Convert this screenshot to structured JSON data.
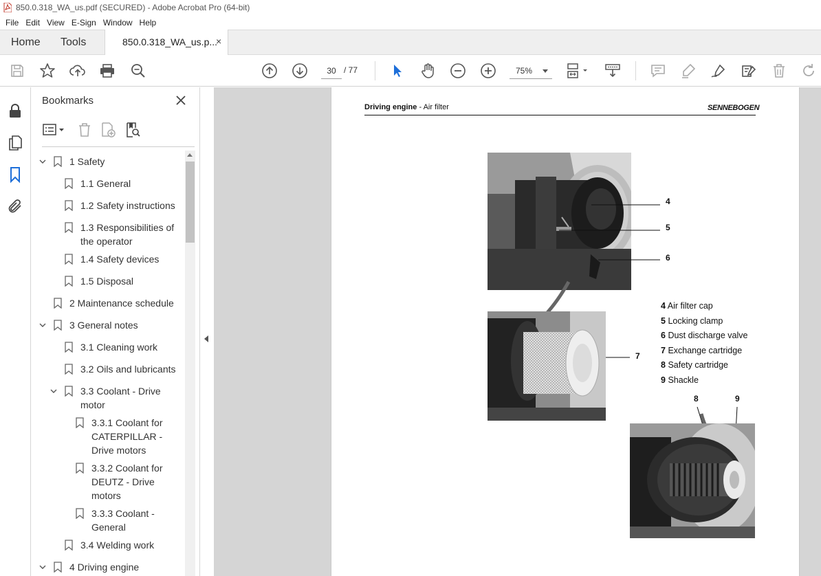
{
  "window": {
    "title": "850.0.318_WA_us.pdf (SECURED) - Adobe Acrobat Pro (64-bit)"
  },
  "menu": [
    "File",
    "Edit",
    "View",
    "E-Sign",
    "Window",
    "Help"
  ],
  "tabs": {
    "home": "Home",
    "tools": "Tools",
    "document": "850.0.318_WA_us.p...",
    "close": "×"
  },
  "toolbar": {
    "current_page": "30",
    "total_pages": "/ 77",
    "zoom": "75%",
    "icons": [
      "save-icon",
      "bookmark-star-icon",
      "upload-icon",
      "print-icon",
      "find-icon",
      "page-up-icon",
      "page-down-icon",
      "select-cursor-icon",
      "hand-icon",
      "zoom-out-icon",
      "zoom-in-icon",
      "fit-page-icon",
      "scroll-mode-icon",
      "comment-icon",
      "highlight-icon",
      "draw-icon",
      "fill-sign-icon",
      "delete-icon",
      "rotate-icon"
    ]
  },
  "panel": {
    "title": "Bookmarks",
    "items": [
      {
        "label": "1 Safety",
        "level": 0,
        "expanded": true,
        "has_children": true
      },
      {
        "label": "1.1 General",
        "level": 1
      },
      {
        "label": "1.2 Safety instructions",
        "level": 1
      },
      {
        "label": "1.3 Responsibilities of",
        "label2": "the operator",
        "level": 1
      },
      {
        "label": "1.4 Safety devices",
        "level": 1
      },
      {
        "label": "1.5 Disposal",
        "level": 1
      },
      {
        "label": "2 Maintenance schedule",
        "level": 0
      },
      {
        "label": "3 General notes",
        "level": 0,
        "expanded": true,
        "has_children": true
      },
      {
        "label": "3.1 Cleaning work",
        "level": 1
      },
      {
        "label": "3.2 Oils and lubricants",
        "level": 1
      },
      {
        "label": "3.3 Coolant - Drive",
        "label2": "motor",
        "level": 1,
        "expanded": true,
        "has_children": true
      },
      {
        "label": "3.3.1 Coolant for",
        "label2": "CATERPILLAR -",
        "label3": "Drive motors",
        "level": 2
      },
      {
        "label": "3.3.2 Coolant for",
        "label2": "DEUTZ - Drive",
        "label3": "motors",
        "level": 2
      },
      {
        "label": "3.3.3 Coolant -",
        "label2": "General",
        "level": 2
      },
      {
        "label": "3.4 Welding work",
        "level": 1
      },
      {
        "label": "4 Driving engine",
        "level": 0,
        "expanded": true,
        "has_children": true
      }
    ]
  },
  "page": {
    "header_bold": "Driving engine",
    "header_rest": " - Air filter",
    "brand": "SENNEBOGEN",
    "callouts": [
      "4",
      "5",
      "6",
      "7",
      "8",
      "9"
    ],
    "legend": [
      {
        "num": "4",
        "text": "Air filter cap"
      },
      {
        "num": "5",
        "text": "Locking clamp"
      },
      {
        "num": "6",
        "text": "Dust discharge valve"
      },
      {
        "num": "7",
        "text": "Exchange cartridge"
      },
      {
        "num": "8",
        "text": "Safety cartridge"
      },
      {
        "num": "9",
        "text": "Shackle"
      }
    ]
  }
}
